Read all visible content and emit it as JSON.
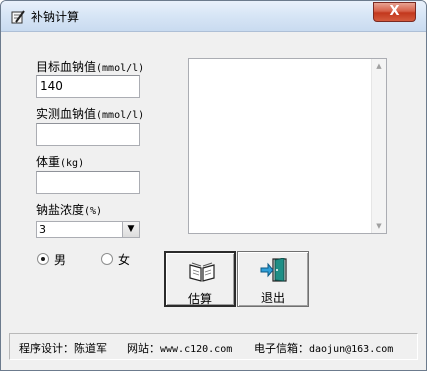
{
  "window": {
    "title": "补钠计算",
    "close_glyph": "X"
  },
  "form": {
    "target_label": "目标血钠值",
    "target_unit": "(mmol/l)",
    "target_value": "140",
    "measured_label": "实测血钠值",
    "measured_unit": "(mmol/l)",
    "measured_value": "",
    "weight_label": "体重",
    "weight_unit": "(kg)",
    "weight_value": "",
    "concentration_label": "钠盐浓度",
    "concentration_unit": "(%)",
    "concentration_value": "3",
    "sex_male": "男",
    "sex_female": "女",
    "selected_sex": "male"
  },
  "buttons": {
    "estimate": "估算",
    "exit": "退出"
  },
  "status": {
    "designer_label": "程序设计：",
    "designer_name": "陈道军",
    "website_label": "网站：",
    "website_url": "www.c120.com",
    "email_label": "电子信箱：",
    "email_address": "daojun@163.com"
  },
  "icons": {
    "app": "pen-notebook-icon",
    "estimate": "open-book-icon",
    "exit": "exit-door-icon"
  }
}
